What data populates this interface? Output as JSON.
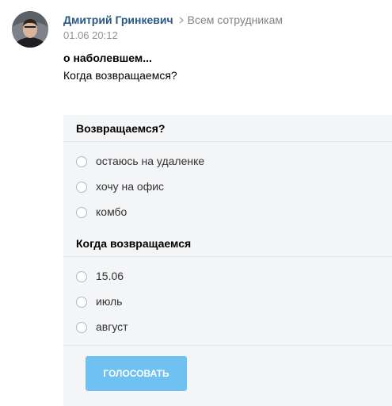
{
  "post": {
    "author": "Дмитрий Гринкевич",
    "audience": "Всем сотрудникам",
    "date": "01.06 20:12",
    "title": "о наболевшем...",
    "text": "Когда возвращаемся?"
  },
  "icons": {
    "avatar": "user-avatar",
    "separator": "chevron-right-icon",
    "option_marker": "radio-circle-icon"
  },
  "colors": {
    "author_link": "#2a5885",
    "poll_background": "#f4f5f7",
    "vote_button": "#6ec1f0"
  },
  "poll": {
    "questions": [
      {
        "title": "Возвращаемся?",
        "options": [
          "остаюсь на удаленке",
          "хочу на офис",
          "комбо"
        ]
      },
      {
        "title": "Когда возвращаемся",
        "options": [
          "15.06",
          "июль",
          "август"
        ]
      }
    ],
    "vote_label": "ГОЛОСОВАТЬ"
  }
}
